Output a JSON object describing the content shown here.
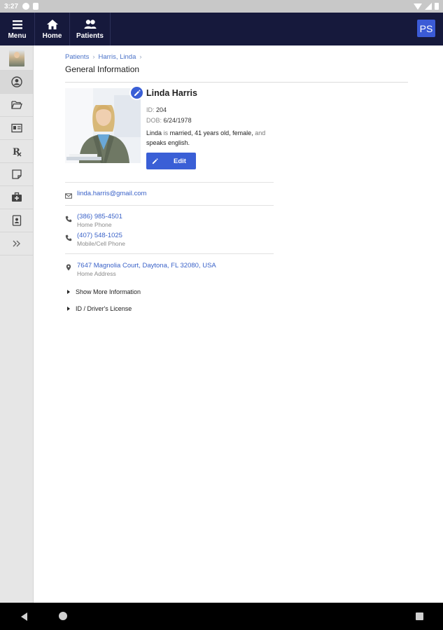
{
  "status_bar": {
    "time": "3:27"
  },
  "topnav": {
    "menu_label": "Menu",
    "home_label": "Home",
    "patients_label": "Patients",
    "user_initials": "PS"
  },
  "sidebar": {
    "items": [
      "avatar-thumb",
      "person-icon",
      "folder-icon",
      "id-card-icon",
      "rx-icon",
      "note-icon",
      "medical-kit-icon",
      "contact-book-icon",
      "expand-icon"
    ],
    "rx_label": "℞",
    "expand_label": "»"
  },
  "breadcrumb": {
    "items": [
      "Patients",
      "Harris, Linda"
    ]
  },
  "page": {
    "title": "General Information"
  },
  "patient": {
    "name": "Linda Harris",
    "id_label": "ID:",
    "id_value": "204",
    "dob_label": "DOB:",
    "dob_value": "6/24/1978",
    "summary": {
      "first_name": "Linda",
      "is": "is",
      "married": "married",
      "age": "41 years old",
      "sex": "female",
      "and": "and",
      "speaks": "speaks english."
    },
    "edit_label": "Edit"
  },
  "contact": {
    "email": "linda.harris@gmail.com",
    "home_phone": "(386) 985-4501",
    "home_phone_label": "Home Phone",
    "mobile_phone": "(407) 548-1025",
    "mobile_phone_label": "Mobile/Cell Phone",
    "address": "7647 Magnolia Court, Daytona, FL 32080, USA",
    "address_label": "Home Address"
  },
  "expanders": {
    "more_info": "Show More Information",
    "license": "ID / Driver's License"
  },
  "colors": {
    "nav_bg": "#16193c",
    "accent": "#3a5fd6",
    "link": "#3a62c8"
  }
}
